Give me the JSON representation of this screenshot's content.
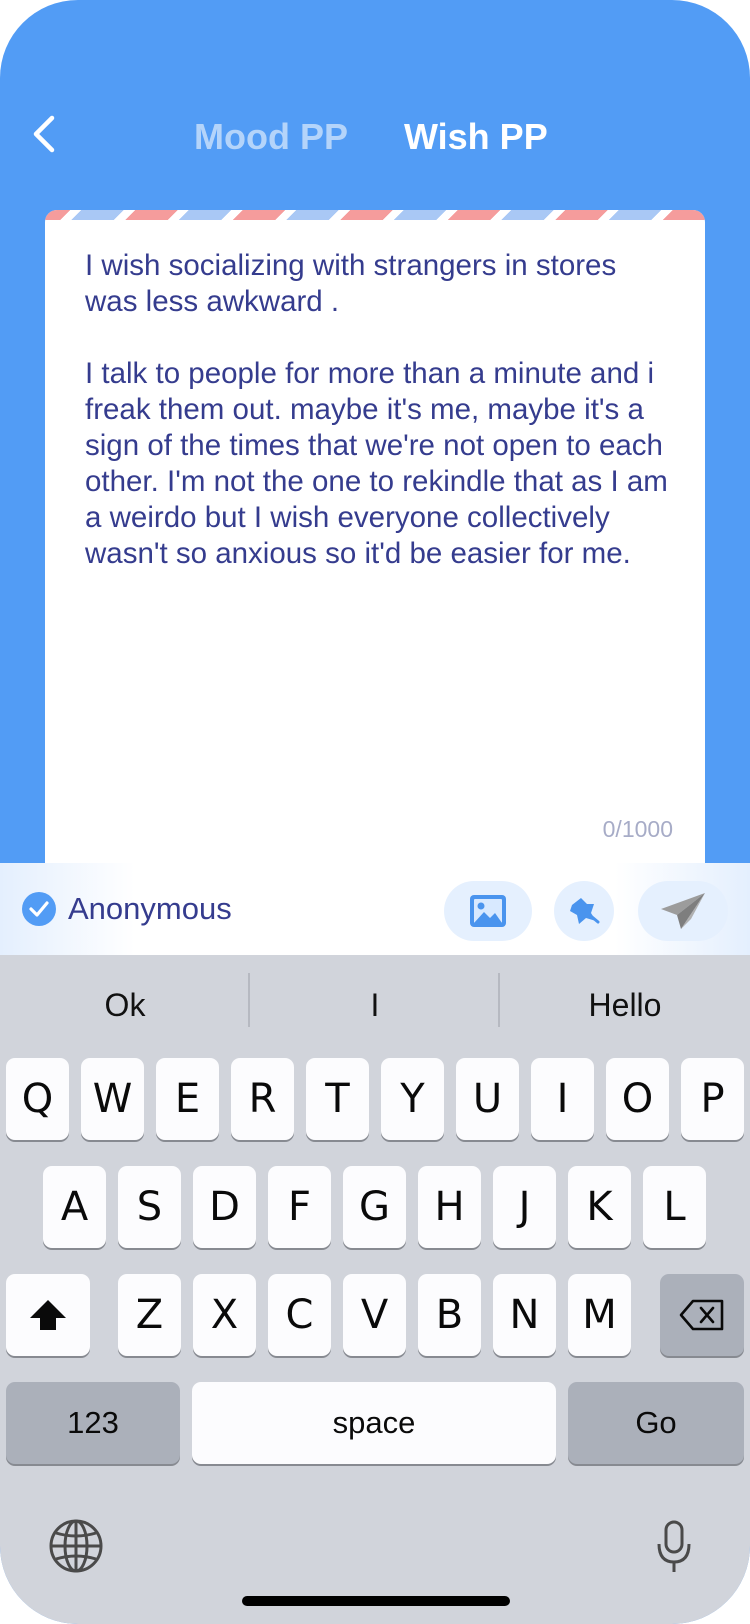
{
  "header": {
    "back_icon": "chevron-left-icon",
    "tabs": [
      {
        "label": "Mood PP",
        "active": false
      },
      {
        "label": "Wish PP",
        "active": true
      }
    ]
  },
  "editor": {
    "text": "I wish socializing with strangers in stores was less awkward .\n\nI talk to people for more than a minute and i freak them out. maybe it's me, maybe it's a sign of the times that we're not open to each other. I'm not the one to rekindle that as I am a weirdo but I wish everyone collectively wasn't so anxious so it'd be easier for me.",
    "counter": "0/1000"
  },
  "actions": {
    "anonymous_label": "Anonymous",
    "anonymous_checked": true,
    "icons": [
      "image-icon",
      "sticker-icon",
      "send-icon"
    ]
  },
  "keyboard": {
    "predictions": [
      "Ok",
      "I",
      "Hello"
    ],
    "row1": [
      "Q",
      "W",
      "E",
      "R",
      "T",
      "Y",
      "U",
      "I",
      "O",
      "P"
    ],
    "row2": [
      "A",
      "S",
      "D",
      "F",
      "G",
      "H",
      "J",
      "K",
      "L"
    ],
    "row3": [
      "Z",
      "X",
      "C",
      "V",
      "B",
      "N",
      "M"
    ],
    "numbers_label": "123",
    "space_label": "space",
    "go_label": "Go"
  },
  "colors": {
    "background": "#529CF5",
    "text": "#353C8E",
    "inactive_tab": "#B4D4FA",
    "keyboard_bg": "#D1D4DB"
  }
}
